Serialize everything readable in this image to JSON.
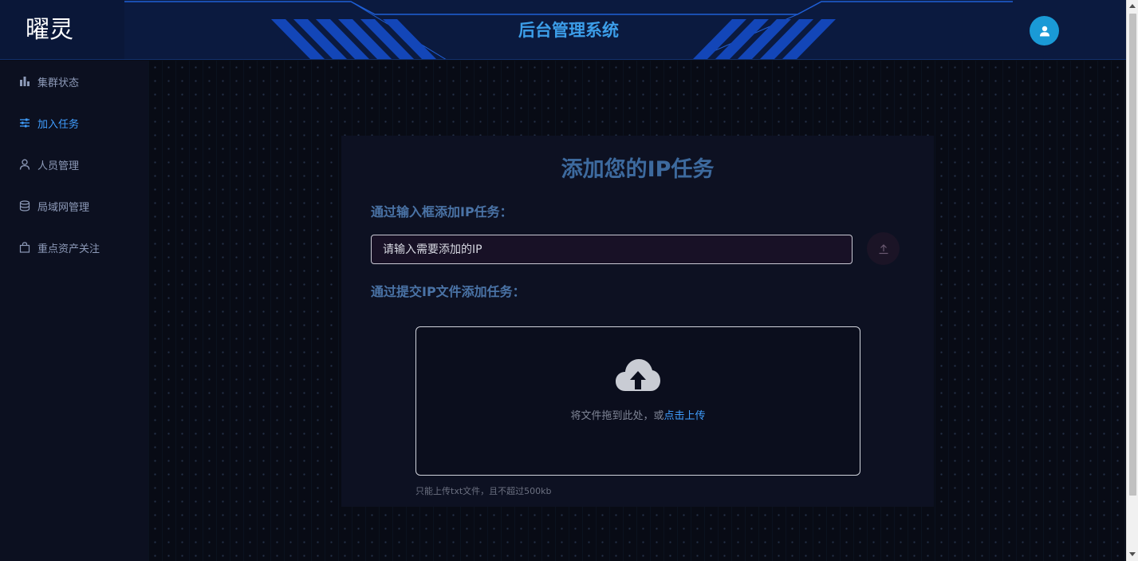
{
  "header": {
    "logo_text": "曜灵",
    "system_title": "后台管理系统",
    "avatar_icon": "user-icon"
  },
  "sidebar": {
    "active_index": 1,
    "items": [
      {
        "label": "集群状态",
        "icon": "bar-chart-icon"
      },
      {
        "label": "加入任务",
        "icon": "sliders-icon"
      },
      {
        "label": "人员管理",
        "icon": "user-outline-icon"
      },
      {
        "label": "局域网管理",
        "icon": "database-icon"
      },
      {
        "label": "重点资产关注",
        "icon": "shopping-bag-icon"
      }
    ]
  },
  "main": {
    "card_title": "添加您的IP任务",
    "input_section_label": "通过输入框添加IP任务：",
    "ip_input_placeholder": "请输入需要添加的IP",
    "ip_input_value": "",
    "submit_icon": "upload-arrow-icon",
    "file_section_label": "通过提交IP文件添加任务：",
    "upload": {
      "icon": "cloud-upload-icon",
      "drag_text": "将文件拖到此处，或",
      "click_text": "点击上传",
      "tip": "只能上传txt文件，且不超过500kb"
    }
  },
  "colors": {
    "accent": "#409eff",
    "title_blue": "#3c9ee9",
    "header_bg": "#0b1a3f",
    "sidebar_bg": "#0c1020",
    "card_bg": "#0d1122",
    "avatar_bg": "#1a9ad6"
  }
}
